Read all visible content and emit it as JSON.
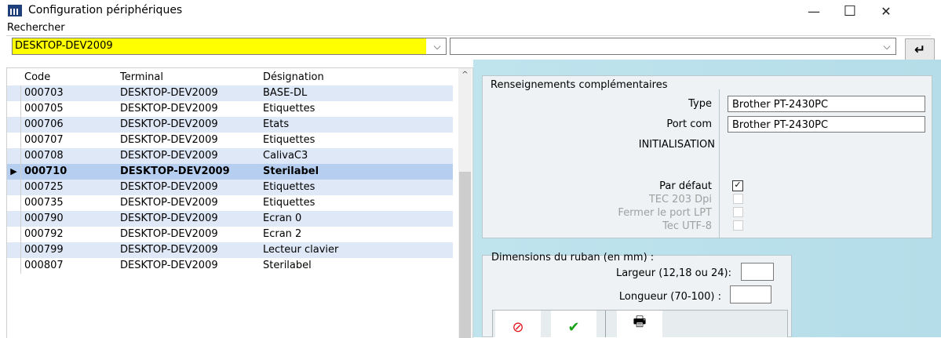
{
  "window": {
    "title": "Configuration périphériques",
    "app_icon": "device-config-icon",
    "buttons": {
      "minimize": "—",
      "maximize": "☐",
      "close": "✕"
    }
  },
  "search": {
    "label": "Rechercher",
    "terminal_value": "DESKTOP-DEV2009",
    "second_value": "",
    "enter_glyph": "↵",
    "highlight_color": "#ffff00"
  },
  "table": {
    "headers": {
      "code": "Code",
      "terminal": "Terminal",
      "designation": "Désignation"
    },
    "rows": [
      {
        "code": "000703",
        "terminal": "DESKTOP-DEV2009",
        "designation": "BASE-DL",
        "selected": false
      },
      {
        "code": "000705",
        "terminal": "DESKTOP-DEV2009",
        "designation": "Etiquettes",
        "selected": false
      },
      {
        "code": "000706",
        "terminal": "DESKTOP-DEV2009",
        "designation": "Etats",
        "selected": false
      },
      {
        "code": "000707",
        "terminal": "DESKTOP-DEV2009",
        "designation": "Etiquettes",
        "selected": false
      },
      {
        "code": "000708",
        "terminal": "DESKTOP-DEV2009",
        "designation": "CalivaC3",
        "selected": false
      },
      {
        "code": "000710",
        "terminal": "DESKTOP-DEV2009",
        "designation": "Sterilabel",
        "selected": true
      },
      {
        "code": "000725",
        "terminal": "DESKTOP-DEV2009",
        "designation": "Etiquettes",
        "selected": false
      },
      {
        "code": "000735",
        "terminal": "DESKTOP-DEV2009",
        "designation": "Etiquettes",
        "selected": false
      },
      {
        "code": "000790",
        "terminal": "DESKTOP-DEV2009",
        "designation": "Ecran 0",
        "selected": false
      },
      {
        "code": "000792",
        "terminal": "DESKTOP-DEV2009",
        "designation": "Ecran 2",
        "selected": false
      },
      {
        "code": "000799",
        "terminal": "DESKTOP-DEV2009",
        "designation": "Lecteur clavier",
        "selected": false
      },
      {
        "code": "000807",
        "terminal": "DESKTOP-DEV2009",
        "designation": "Sterilabel",
        "selected": false
      }
    ],
    "selected_marker": "▶",
    "row_alt_color": "#dfe8f6",
    "row_selected_color": "#b6cff0"
  },
  "details": {
    "title": "Renseignements complémentaires",
    "type_label": "Type",
    "type_value": "Brother PT-2430PC",
    "port_label": "Port com",
    "port_value": "Brother PT-2430PC",
    "init_label": "INITIALISATION",
    "default_label": "Par défaut",
    "default_checked": true,
    "tec203_label": "TEC 203 Dpi",
    "lpt_label": "Fermer le port LPT",
    "utf8_label": "Tec UTF-8",
    "check_glyph": "✓"
  },
  "ribbon": {
    "title": "Dimensions du ruban  (en mm) :",
    "width_label": "Largeur (12,18 ou 24):",
    "width_value": "",
    "length_label": "Longueur (70-100) :",
    "length_value": ""
  },
  "toolbar": {
    "cancel_icon": "⊘",
    "ok_icon": "✔",
    "print_icon": "🖶",
    "cancel_color": "#e0141e",
    "ok_color": "#1aa31a"
  }
}
